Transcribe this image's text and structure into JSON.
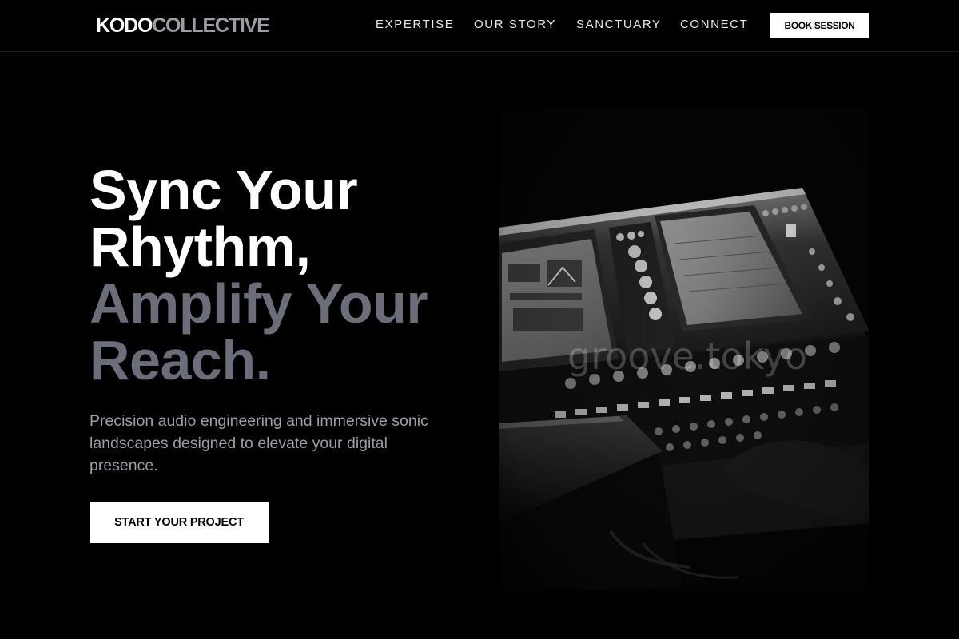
{
  "header": {
    "logo_part1": "KODO",
    "logo_part2": "COLLECTIVE",
    "nav": [
      "EXPERTISE",
      "OUR STORY",
      "SANCTUARY",
      "CONNECT"
    ],
    "book_button": "BOOK SESSION"
  },
  "hero": {
    "headline_line1": "Sync Your",
    "headline_line2": "Rhythm,",
    "headline_line3": "Amplify Your",
    "headline_line4": "Reach.",
    "subtext": "Precision audio engineering and immersive sonic landscapes designed to elevate your digital presence.",
    "cta": "START YOUR PROJECT",
    "image_watermark": "groove.tokyo"
  },
  "colors": {
    "background": "#000000",
    "text_primary": "#ffffff",
    "text_muted": "#9a9ea6",
    "headline_accent": "#6b6e78"
  }
}
